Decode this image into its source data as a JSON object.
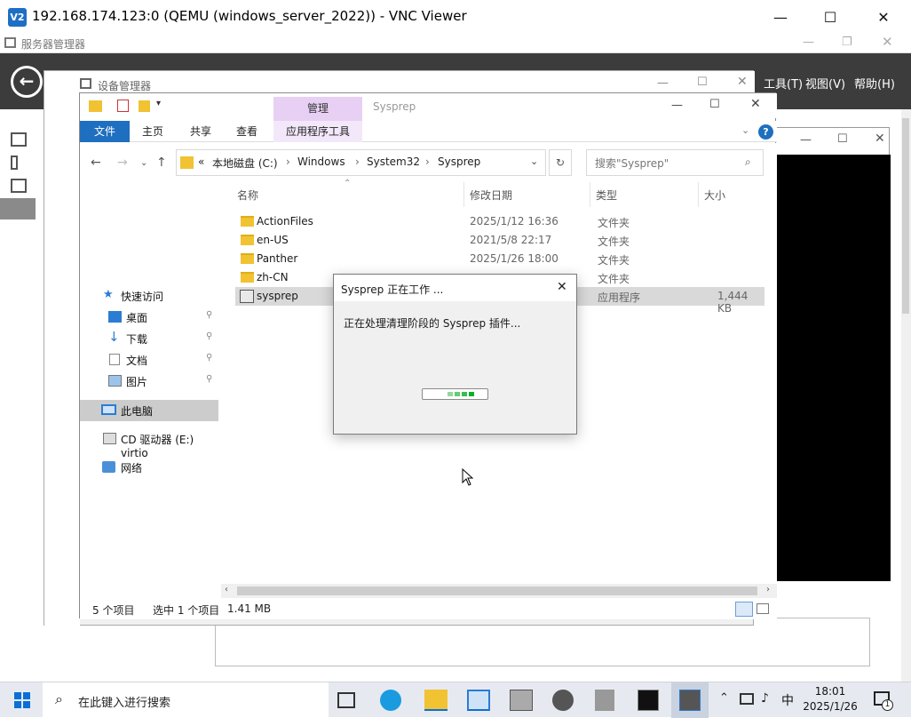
{
  "vnc": {
    "title": "192.168.174.123:0 (QEMU (windows_server_2022)) - VNC Viewer",
    "logo": "V2"
  },
  "server_manager": {
    "title": "服务器管理器",
    "menu": [
      "工具(T)",
      "视图(V)",
      "帮助(H)"
    ]
  },
  "device_manager": {
    "title": "设备管理器"
  },
  "explorer": {
    "context_tab": "管理",
    "system_title": "Sysprep",
    "tabs": [
      "文件",
      "主页",
      "共享",
      "查看",
      "应用程序工具"
    ],
    "breadcrumbs": [
      "«",
      "本地磁盘 (C:)",
      "Windows",
      "System32",
      "Sysprep"
    ],
    "search_placeholder": "搜索\"Sysprep\"",
    "nav": {
      "quick_access": "快速访问",
      "items": [
        "桌面",
        "下载",
        "文档",
        "图片"
      ],
      "this_pc": "此电脑",
      "cd_drive": "CD 驱动器 (E:) virtio",
      "network": "网络"
    },
    "columns": [
      "名称",
      "修改日期",
      "类型",
      "大小"
    ],
    "files": [
      {
        "name": "ActionFiles",
        "date": "2025/1/12 16:36",
        "type": "文件夹",
        "size": ""
      },
      {
        "name": "en-US",
        "date": "2021/5/8 22:17",
        "type": "文件夹",
        "size": ""
      },
      {
        "name": "Panther",
        "date": "2025/1/26 18:00",
        "type": "文件夹",
        "size": ""
      },
      {
        "name": "zh-CN",
        "date": "",
        "type": "文件夹",
        "size": ""
      },
      {
        "name": "sysprep",
        "date": "",
        "type": "应用程序",
        "size": "1,444 KB"
      }
    ],
    "status": {
      "count": "5 个项目",
      "selected": "选中 1 个项目",
      "size": "1.41 MB"
    }
  },
  "dialog": {
    "title": "Sysprep 正在工作 ...",
    "message": "正在处理清理阶段的 Sysprep 插件...",
    "progress_blocks": 4
  },
  "taskbar": {
    "search_placeholder": "在此键入进行搜索",
    "ime": "中",
    "time": "18:01",
    "date": "2025/1/26",
    "notification_count": "1"
  },
  "colors": {
    "accent": "#1f6fc0",
    "context_tab": "#e8d0f4",
    "progress": "#06b025"
  }
}
